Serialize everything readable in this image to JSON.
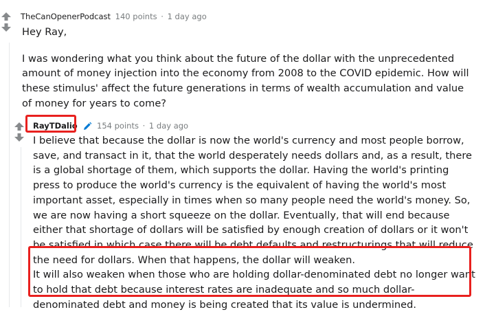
{
  "comment1": {
    "author": "TheCanOpenerPodcast",
    "points": "140 points",
    "separator": "·",
    "time": "1 day ago",
    "greeting": "Hey Ray,",
    "body": "I was wondering what you think about the future of the dollar with the unprecedented amount of money injection into the economy from 2008 to the COVID epidemic. How will these stimulus' affect the future generations in terms of wealth accumulation and value of money for years to come?"
  },
  "comment2": {
    "author": "RayTDalio",
    "points": "154 points",
    "separator": "·",
    "time": "1 day ago",
    "body": "I believe that because the dollar is now the world's currency and most people borrow, save, and transact in it, that the world desperately needs dollars and, as a result, there is a global shortage of them, which supports the dollar. Having the world's printing press to produce the world's currency is the equivalent of having the world's most important asset, especially in times when so many people need the world's money. So, we are now having a short squeeze on the dollar. Eventually, that will end because either that shortage of dollars will be satisfied by enough creation of dollars or it won't be satisfied in which case there will be debt defaults and restructurings that will reduce the need for dollars. When that happens, the dollar will weaken.",
    "highlighted": "It will also weaken when those who are holding dollar-denominated debt no longer want to hold that debt because interest rates are inadequate and so much dollar-denominated debt and money is being created that its value is undermined."
  },
  "colors": {
    "highlight": "#e8201e",
    "arrow": "#878a8c",
    "meta": "#787c7e",
    "text": "#1a1a1b",
    "mod_icon": "#0079d3"
  },
  "icons": {
    "upvote": "upvote-arrow-icon",
    "downvote": "downvote-arrow-icon",
    "mod": "pencil-icon"
  }
}
